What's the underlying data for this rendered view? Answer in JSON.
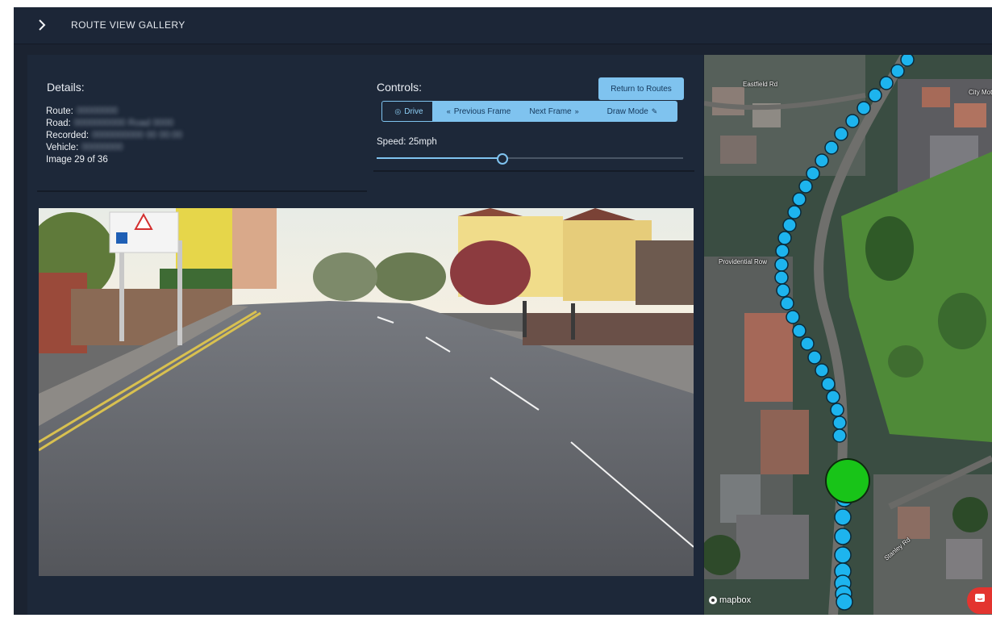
{
  "app": {
    "title": "ROUTE VIEW GALLERY"
  },
  "details": {
    "heading": "Details:",
    "route_label": "Route:",
    "route_value": "00000000",
    "road_label": "Road:",
    "road_value": "0000000000 Road 0000",
    "recorded_label": "Recorded:",
    "recorded_value": "0000000000 00 00:00",
    "vehicle_label": "Vehicle:",
    "vehicle_value": "00000000",
    "image_counter": "Image 29 of 36"
  },
  "controls": {
    "heading": "Controls:",
    "return_label": "Return to Routes",
    "drive_label": "Drive",
    "prev_label": "Previous Frame",
    "next_label": "Next Frame",
    "draw_label": "Draw Mode",
    "speed_label": "Speed: 25mph",
    "speed_fraction": 0.41
  },
  "map": {
    "labels": {
      "eastfield": "Eastfield Rd",
      "providential": "Providential Row",
      "stanley": "Stanley Rd",
      "city": "City Mot"
    },
    "attribution": "mapbox",
    "route_color": "#1db4ee",
    "current_color": "#18c418"
  },
  "colors": {
    "accent": "#7fc3ef",
    "chat": "#e3342f"
  }
}
